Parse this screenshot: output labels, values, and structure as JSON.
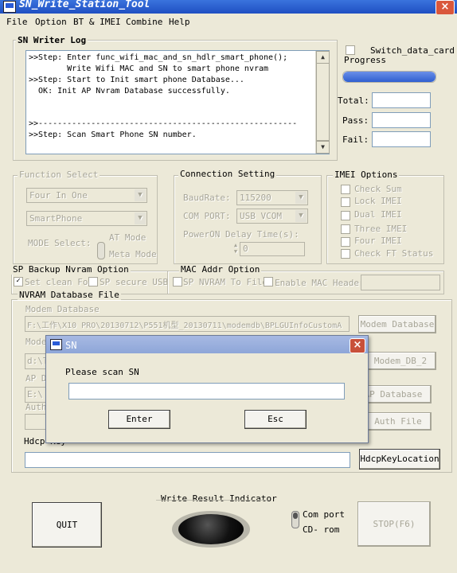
{
  "window": {
    "title": "SN_Write_Station_Tool",
    "close": "×"
  },
  "menu": {
    "file": "File",
    "option": "Option",
    "bt_imei": "BT & IMEI",
    "combine": "Combine",
    "help": "Help"
  },
  "log": {
    "title": "SN Writer Log",
    "lines": [
      ">>Step: Enter func_wifi_mac_and_sn_hdlr_smart_phone();",
      "        Write Wifi MAC and SN to smart phone nvram",
      ">>Step: Start to Init smart phone Database...",
      "  OK: Init AP Nvram Database successfully.",
      "",
      ">>------------------------------------------------------",
      ">>Step: Scan Smart Phone SN number."
    ]
  },
  "right_panel": {
    "switch_data_card": "Switch_data_card",
    "progress_label": "Progress",
    "progress_fraction": 1.0,
    "total_label": "Total:",
    "pass_label": "Pass:",
    "fail_label": "Fail:"
  },
  "function_select": {
    "title": "Function Select",
    "mode": "Four In One",
    "target": "SmartPhone",
    "mode_select_label": "MODE Select:",
    "at_mode": "AT Mode",
    "meta_mode": "Meta Mode"
  },
  "connection": {
    "title": "Connection Setting",
    "baud_label": "BaudRate:",
    "baud_value": "115200",
    "com_label": "COM PORT:",
    "com_value": "USB VCOM",
    "delay_label": "PowerON Delay Time(s):",
    "delay_value": "0"
  },
  "imei": {
    "title": "IMEI Options",
    "options": [
      "Check Sum",
      "Lock IMEI",
      "Dual IMEI",
      "Three IMEI",
      "Four IMEI",
      "Check FT Status"
    ]
  },
  "sp_backup": {
    "title": "SP Backup Nvram Option",
    "set_clean": "Set clean Fod",
    "sp_secure": "SP secure USB"
  },
  "mac_addr": {
    "title": "MAC Addr Option",
    "sp_nvram": "SP NVRAM To File",
    "enable_header": "Enable MAC Header"
  },
  "nvram": {
    "title": "NVRAM Database File",
    "modem_label": "Modem Database",
    "modem_path": "F:\\工作\\X10 PRO\\20130712\\P551机型_20130711\\modemdb\\BPLGUInfoCustomA",
    "modem_btn": "Modem Database",
    "modem2_label": "Mode",
    "modem2_path": "d:\\T",
    "modem2_btn": "Modem_DB_2",
    "ap_label": "AP D",
    "ap_path": "E:\\",
    "ap_btn": "AP Database",
    "auth_label": "Auth",
    "auth_btn": "Auth File",
    "hdcp_label": "Hdcp Key",
    "hdcp_btn": "HdcpKeyLocation"
  },
  "bottom": {
    "quit": "QUIT",
    "indicator_title": "Write Result Indicator",
    "com_port": "Com port",
    "cd_rom": "CD- rom",
    "stop": "STOP(F6)"
  },
  "dialog": {
    "title": "SN",
    "close": "×",
    "prompt": "Please scan SN",
    "input_value": "",
    "enter": "Enter",
    "esc": "Esc"
  },
  "colors": {
    "titlebar": "#1f4fc2",
    "face": "#ece9d8",
    "progress": "#2f5fd0"
  }
}
